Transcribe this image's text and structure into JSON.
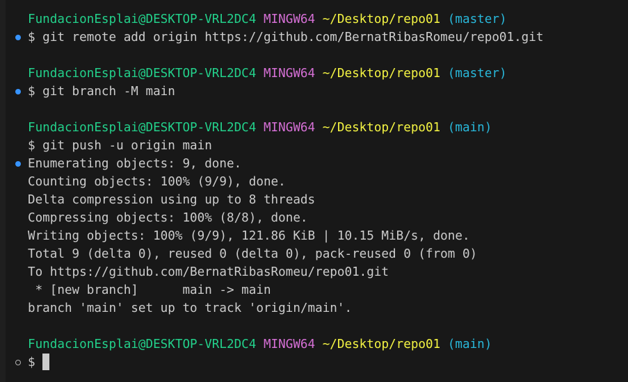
{
  "colors": {
    "background": "#181818",
    "text": "#cccccc",
    "user_host": "#23d18b",
    "system": "#d670d6",
    "path": "#f5f543",
    "branch": "#29b8db",
    "decoration_success": "#3794ff"
  },
  "prompts": [
    {
      "user_host": "FundacionEsplai@DESKTOP-VRL2DC4",
      "system": "MINGW64",
      "path": "~/Desktop/repo01",
      "branch": "(master)"
    },
    {
      "user_host": "FundacionEsplai@DESKTOP-VRL2DC4",
      "system": "MINGW64",
      "path": "~/Desktop/repo01",
      "branch": "(master)"
    },
    {
      "user_host": "FundacionEsplai@DESKTOP-VRL2DC4",
      "system": "MINGW64",
      "path": "~/Desktop/repo01",
      "branch": "(main)"
    },
    {
      "user_host": "FundacionEsplai@DESKTOP-VRL2DC4",
      "system": "MINGW64",
      "path": "~/Desktop/repo01",
      "branch": "(main)"
    }
  ],
  "commands": [
    "$ git remote add origin https://github.com/BernatRibasRomeu/repo01.git",
    "$ git branch -M main",
    "$ git push -u origin main",
    "$ "
  ],
  "output": [
    "Enumerating objects: 9, done.",
    "Counting objects: 100% (9/9), done.",
    "Delta compression using up to 8 threads",
    "Compressing objects: 100% (8/8), done.",
    "Writing objects: 100% (9/9), 121.86 KiB | 10.15 MiB/s, done.",
    "Total 9 (delta 0), reused 0 (delta 0), pack-reused 0 (from 0)",
    "To https://github.com/BernatRibasRomeu/repo01.git",
    " * [new branch]      main -> main",
    "branch 'main' set up to track 'origin/main'."
  ]
}
